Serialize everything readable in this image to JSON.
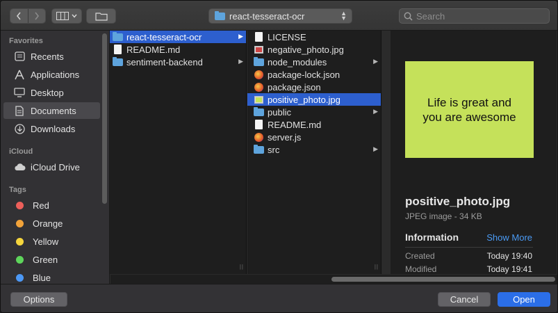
{
  "toolbar": {
    "back_icon": "chevron-left-icon",
    "forward_icon": "chevron-right-icon",
    "view_icon": "column-view-icon",
    "group_icon": "new-folder-icon",
    "path_label": "react-tesseract-ocr",
    "search_placeholder": "Search"
  },
  "sidebar": {
    "favorites_title": "Favorites",
    "favorites": [
      {
        "label": "Recents",
        "icon": "recents-icon"
      },
      {
        "label": "Applications",
        "icon": "applications-icon"
      },
      {
        "label": "Desktop",
        "icon": "desktop-icon"
      },
      {
        "label": "Documents",
        "icon": "documents-icon",
        "selected": true
      },
      {
        "label": "Downloads",
        "icon": "downloads-icon"
      }
    ],
    "icloud_title": "iCloud",
    "icloud": [
      {
        "label": "iCloud Drive",
        "icon": "cloud-icon"
      }
    ],
    "tags_title": "Tags",
    "tags": [
      {
        "label": "Red",
        "color": "#ec5f5a"
      },
      {
        "label": "Orange",
        "color": "#f2a33a"
      },
      {
        "label": "Yellow",
        "color": "#f5d53d"
      },
      {
        "label": "Green",
        "color": "#5ed55b"
      },
      {
        "label": "Blue",
        "color": "#4c98f5"
      }
    ]
  },
  "column1": {
    "items": [
      {
        "label": "react-tesseract-ocr",
        "type": "folder",
        "selected": true,
        "arrow": true
      },
      {
        "label": "README.md",
        "type": "doc"
      },
      {
        "label": "sentiment-backend",
        "type": "folder",
        "arrow": true
      }
    ]
  },
  "column2": {
    "items": [
      {
        "label": "LICENSE",
        "type": "doc"
      },
      {
        "label": "negative_photo.jpg",
        "type": "img-red"
      },
      {
        "label": "node_modules",
        "type": "folder",
        "arrow": true
      },
      {
        "label": "package-lock.json",
        "type": "js"
      },
      {
        "label": "package.json",
        "type": "js"
      },
      {
        "label": "positive_photo.jpg",
        "type": "img-green",
        "selected": true
      },
      {
        "label": "public",
        "type": "folder",
        "arrow": true
      },
      {
        "label": "README.md",
        "type": "doc"
      },
      {
        "label": "server.js",
        "type": "js"
      },
      {
        "label": "src",
        "type": "folder",
        "arrow": true
      }
    ]
  },
  "preview": {
    "image_text_line1": "Life is great and",
    "image_text_line2": "you are awesome",
    "image_color": "#c5e15a",
    "file_name": "positive_photo.jpg",
    "file_kind": "JPEG image - 34 KB",
    "info_title": "Information",
    "show_more": "Show More",
    "created_label": "Created",
    "created_value": "Today 19:40",
    "modified_label": "Modified",
    "modified_value": "Today 19:41"
  },
  "footer": {
    "options_label": "Options",
    "cancel_label": "Cancel",
    "open_label": "Open"
  },
  "colors": {
    "selection": "#2d5fce",
    "primary_button": "#2b6ee8",
    "link": "#4b9bf5"
  }
}
